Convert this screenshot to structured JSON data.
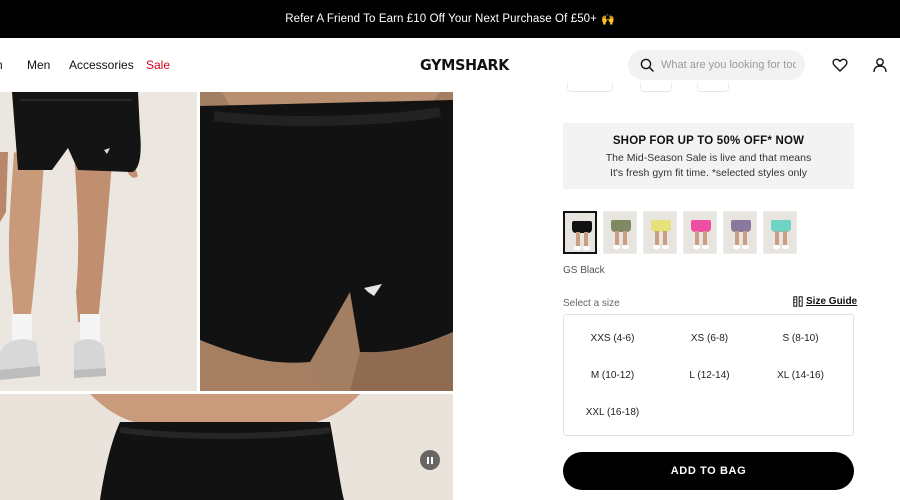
{
  "promo": {
    "text": "Refer A Friend To Earn £10 Off Your Next Purchase Of £50+",
    "emoji": "🙌"
  },
  "nav": {
    "items": [
      "n",
      "Men",
      "Accessories",
      "Sale"
    ],
    "sale_color": "#d6001c"
  },
  "logo": "GYMSHARK",
  "search": {
    "placeholder": "What are you looking for tod..."
  },
  "icons": {
    "search": "search-icon",
    "wishlist": "heart-icon",
    "account": "user-icon",
    "size_guide": "ruler-icon",
    "media": "pause-icon"
  },
  "sale_banner": {
    "title": "SHOP FOR UP TO 50% OFF* NOW",
    "description": "The Mid-Season Sale is live and that means It's fresh gym fit time. *selected styles only"
  },
  "swatches": [
    {
      "name": "GS Black",
      "color": "#111111",
      "selected": true
    },
    {
      "name": "olive",
      "color": "#7e8b62",
      "selected": false
    },
    {
      "name": "yellow",
      "color": "#e6e27a",
      "selected": false
    },
    {
      "name": "pink",
      "color": "#ee4fa5",
      "selected": false
    },
    {
      "name": "purple",
      "color": "#8a789e",
      "selected": false
    },
    {
      "name": "mint",
      "color": "#6ed3c2",
      "selected": false
    }
  ],
  "selected_color": "GS Black",
  "size": {
    "label": "Select a size",
    "guide": "Size Guide",
    "options": [
      "XXS (4-6)",
      "XS (6-8)",
      "S (8-10)",
      "M (10-12)",
      "L (12-14)",
      "XL (14-16)",
      "XXL (16-18)"
    ]
  },
  "cta": "ADD TO BAG"
}
